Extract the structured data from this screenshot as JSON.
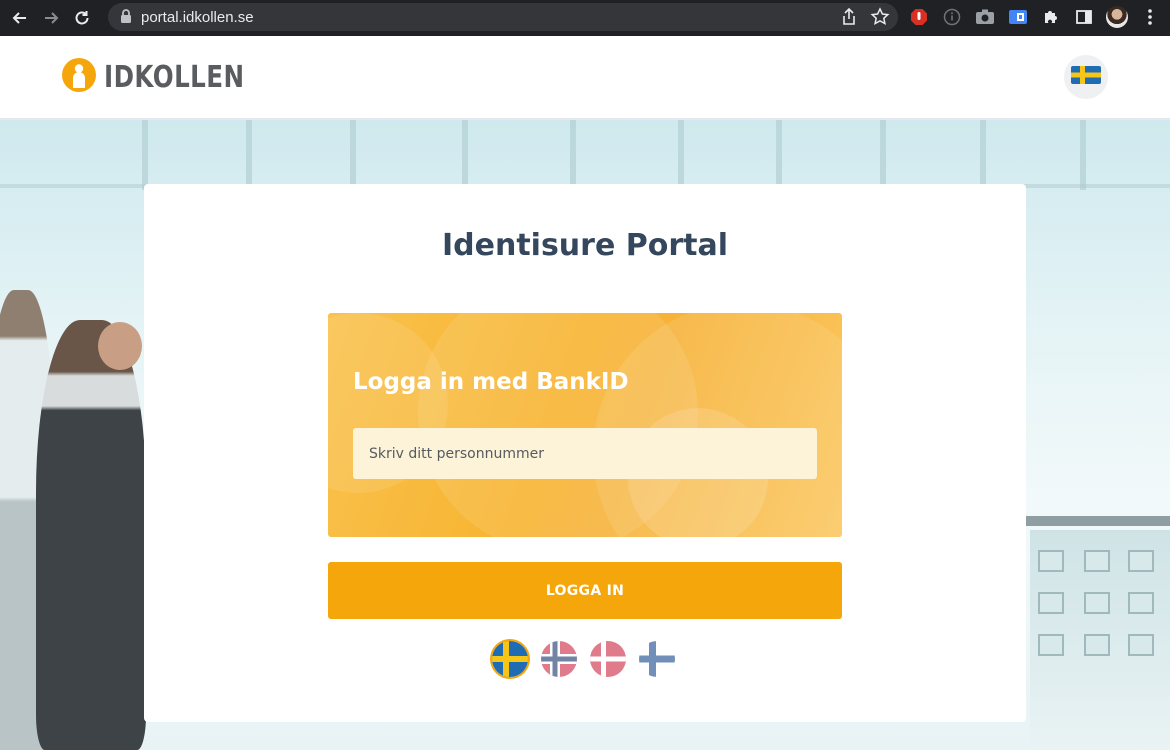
{
  "browser": {
    "url": "portal.idkollen.se"
  },
  "header": {
    "logo_text": "IDKOLLEN",
    "language_flag": "se-flag-icon"
  },
  "card": {
    "title": "Identisure Portal",
    "bankid": {
      "title": "Logga in med BankID",
      "input_placeholder": "Skriv ditt personnummer",
      "input_value": ""
    },
    "login_button": "LOGGA IN",
    "languages": [
      {
        "code": "se",
        "icon": "sweden-flag-icon",
        "selected": true
      },
      {
        "code": "no",
        "icon": "norway-flag-icon",
        "selected": false
      },
      {
        "code": "dk",
        "icon": "denmark-flag-icon",
        "selected": false
      },
      {
        "code": "fi",
        "icon": "finland-flag-icon",
        "selected": false
      }
    ]
  },
  "colors": {
    "brand_orange": "#f5a60a",
    "title_navy": "#34475d",
    "panel_orange": "#f8b431"
  }
}
